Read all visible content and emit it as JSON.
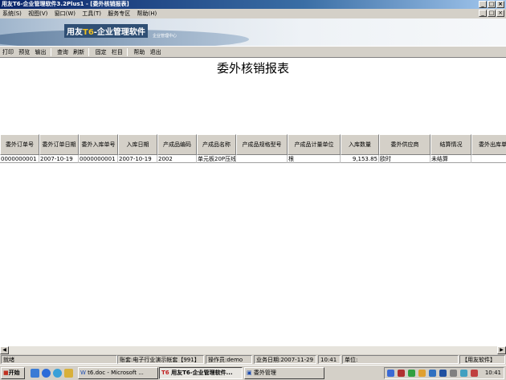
{
  "window": {
    "title": "用友T6-企业管理软件3.2Plus1  - [委外核销报表]",
    "buttons": [
      "_",
      "□",
      "×"
    ]
  },
  "menu": {
    "items": [
      "系统(S)",
      "视图(V)",
      "窗口(W)",
      "工具(T)",
      "服务专区",
      "帮助(H)"
    ],
    "mdi_buttons": [
      "_",
      "□",
      "×"
    ]
  },
  "banner": {
    "logo_prefix": "用友",
    "logo_accent": "T6",
    "logo_suffix": "-企业管理软件",
    "sub": "企业管理中心"
  },
  "toolbar": {
    "items": [
      "打印",
      "预览",
      "输出",
      "查询",
      "刷新",
      "固定",
      "栏目",
      "帮助",
      "退出"
    ]
  },
  "report": {
    "title": "委外核销报表",
    "columns": [
      "委外订单号",
      "委外订单日期",
      "委外入库单号",
      "入库日期",
      "产成品编码",
      "产成品名称",
      "产成品规格型号",
      "产成品计量单位",
      "入库数量",
      "委外供应商",
      "结算情况",
      "委外出库单号"
    ],
    "rows": [
      [
        "0000000001",
        "2007-10-19",
        "0000000001",
        "2007-10-19",
        "2002",
        "单元板20P压线",
        "",
        "根",
        "9,153.85",
        "欧时",
        "未结算",
        ""
      ]
    ]
  },
  "status": {
    "ready": "就绪",
    "account": "账套:电子行业演示帐套【991】",
    "operator": "操作员:demo",
    "date": "业务日期:2007-11-29",
    "time": "10:41",
    "unit": "单位:",
    "brand": "【用友软件】"
  },
  "taskbar": {
    "start": "开始",
    "tasks": [
      "t6.doc - Microsoft ...",
      "用友T6-企业管理软件...",
      "委外管理"
    ],
    "clock": "10:41"
  },
  "colors": {
    "title_dark": "#0a246a",
    "face": "#d4d0c8"
  }
}
